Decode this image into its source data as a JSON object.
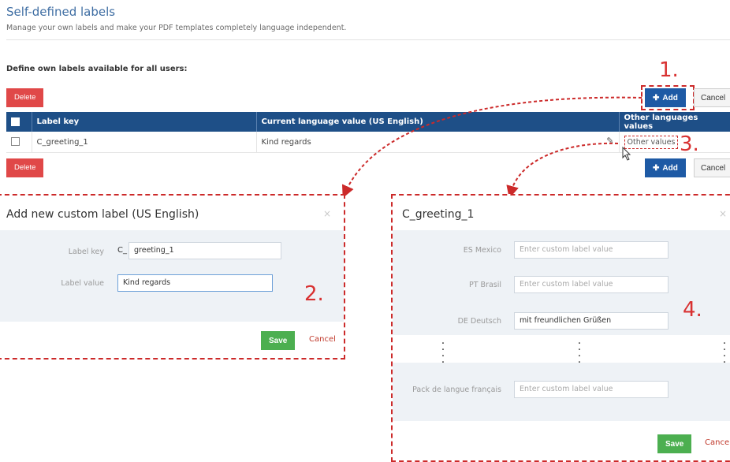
{
  "page": {
    "title": "Self-defined labels",
    "subtitle": "Manage your own labels and make your PDF templates completely language independent.",
    "section_heading": "Define own labels available for all users:"
  },
  "toolbar": {
    "delete_label": "Delete",
    "add_label": "Add",
    "cancel_label": "Cancel"
  },
  "table": {
    "columns": [
      "Label key",
      "Current language value (US English)",
      "Other languages values"
    ],
    "rows": [
      {
        "key": "C_greeting_1",
        "value": "Kind regards",
        "other_link": "Other values"
      }
    ]
  },
  "add_dialog": {
    "title": "Add new custom label (US English)",
    "close": "×",
    "key_label": "Label key",
    "key_prefix": "C_",
    "key_value": "greeting_1",
    "value_label": "Label value",
    "value_value": "Kind regards",
    "save": "Save",
    "cancel": "Cancel"
  },
  "values_dialog": {
    "title": "C_greeting_1",
    "close": "×",
    "fields": [
      {
        "label": "ES Mexico",
        "value": "",
        "placeholder": "Enter custom label value"
      },
      {
        "label": "PT Brasil",
        "value": "",
        "placeholder": "Enter custom label value"
      },
      {
        "label": "DE Deutsch",
        "value": "mit freundlichen Grüßen",
        "placeholder": ""
      },
      {
        "label": "Pack de langue français",
        "value": "",
        "placeholder": "Enter custom label value"
      }
    ],
    "save": "Save",
    "cancel": "Cancel"
  },
  "annotations": {
    "step1": "1.",
    "step2": "2.",
    "step3": "3.",
    "step4": "4.",
    "color": "#cc2a2a"
  },
  "colors": {
    "header": "#1e4f87",
    "add_button": "#1e5aa5",
    "delete_button": "#e04848",
    "save_button": "#4caf50"
  }
}
